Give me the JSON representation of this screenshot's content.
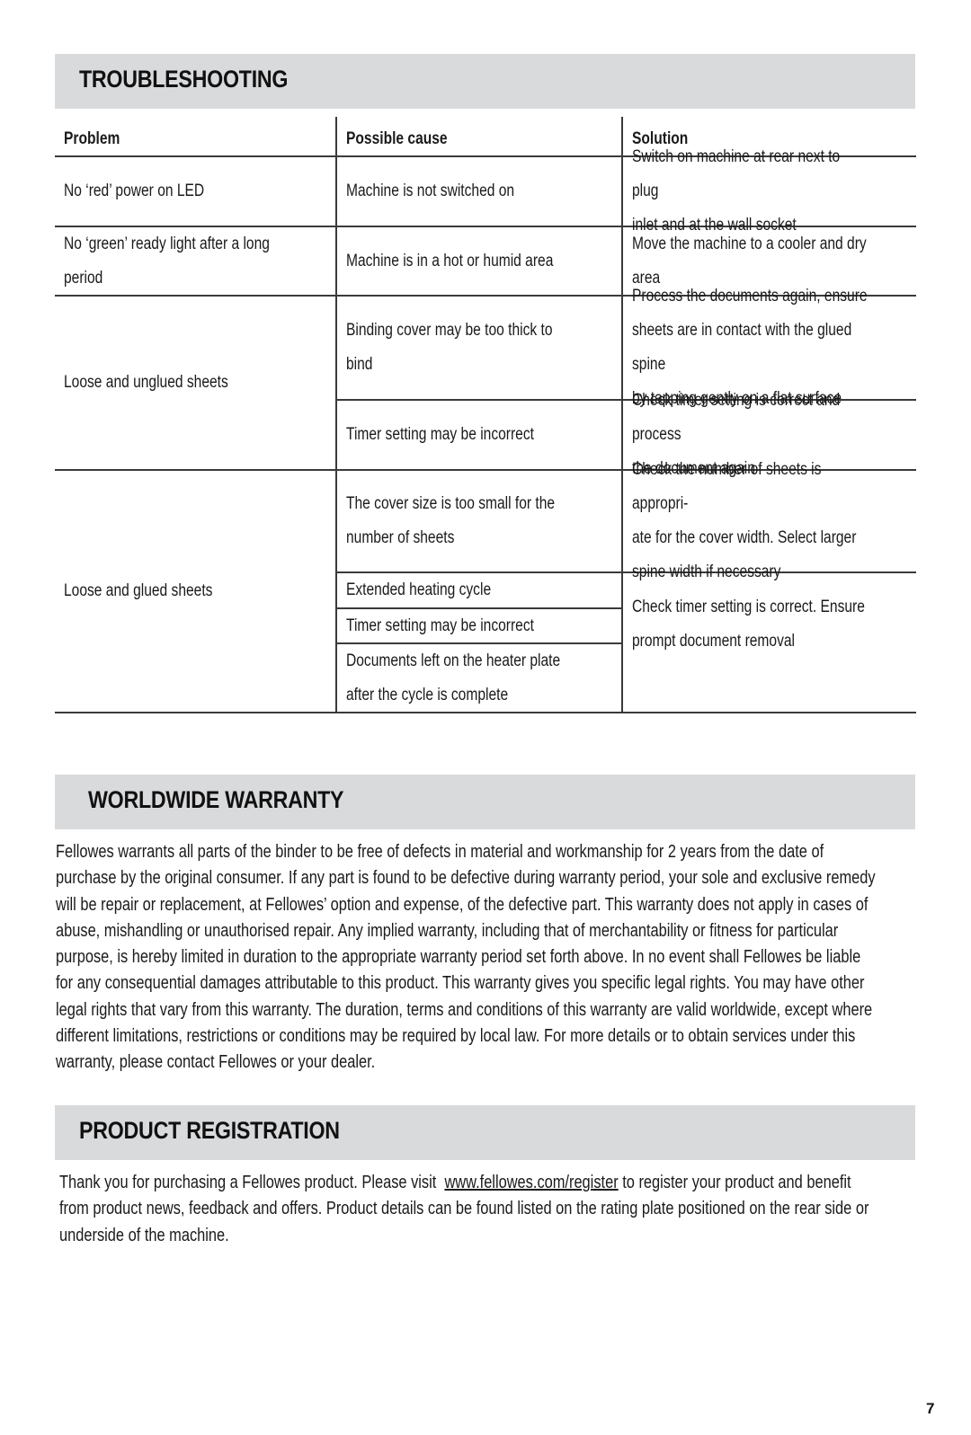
{
  "troubleshooting": {
    "title": "TROUBLESHOOTING",
    "headers": {
      "problem": "Problem",
      "cause": "Possible cause",
      "solution": "Solution"
    },
    "rows": [
      {
        "problem": "No ‘red’ power on LED",
        "causes": [
          "Machine is not switched on"
        ],
        "solutions": [
          "Switch on machine at rear next to plug\ninlet and at the wall socket"
        ]
      },
      {
        "problem": "No ‘green’ ready light after a long\nperiod",
        "causes": [
          "Machine is in a hot or humid area"
        ],
        "solutions": [
          "Move the machine to a cooler and dry\narea"
        ]
      },
      {
        "problem": "Loose and unglued sheets",
        "causes": [
          "Binding cover may be too thick to bind",
          "Timer setting may be incorrect"
        ],
        "solutions": [
          "Process the documents again, ensure\nsheets are in contact with the glued spine\nby tapping gently on a flat surface",
          "Check timer setting is correct and process\nthe document again"
        ]
      },
      {
        "problem": "Loose and glued sheets",
        "causes": [
          "The cover size is too small for the\nnumber of sheets",
          "Extended heating cycle",
          "Timer setting may be incorrect",
          "Documents left on the heater plate\nafter the cycle is complete"
        ],
        "solutions": [
          "Check the number of sheets is appropri-\nate for the cover width. Select larger\nspine width if necessary",
          "Check timer setting is correct. Ensure\nprompt document removal"
        ]
      }
    ]
  },
  "warranty": {
    "title": "WORLDWIDE WARRANTY",
    "lines": [
      "Fellowes warrants all parts of the binder to be free of defects in material and workmanship for 2 years from the date of",
      "purchase by the original consumer. If any part is found to be defective during warranty period, your sole and exclusive remedy",
      "will be repair or replacement, at Fellowes’ option and expense, of the defective part. This warranty does not apply in cases of",
      "abuse, mishandling or unauthorised repair. Any implied warranty, including that of merchantability or fitness for particular",
      "purpose, is hereby limited in duration to the appropriate warranty period set forth above. In no event shall Fellowes be liable",
      "for any consequential damages attributable to this product. This warranty gives you specific legal rights. You may have other",
      "legal rights that vary from this warranty. The duration, terms and conditions of this warranty are valid worldwide, except where",
      "different limitations, restrictions or conditions may be required by local law. For more details or to obtain services under this",
      "warranty, please contact Fellowes or your dealer."
    ]
  },
  "registration": {
    "title": "PRODUCT REGISTRATION",
    "line1_before": "Thank you for purchasing a Fellowes product. Please visit ",
    "link": "www.fellowes.com/register",
    "line1_after": " to register your product and benefit",
    "line2": "from product news, feedback and offers. Product details can be found listed on the rating plate positioned on the rear side or",
    "line3": "underside of the machine."
  },
  "page_number": "7"
}
